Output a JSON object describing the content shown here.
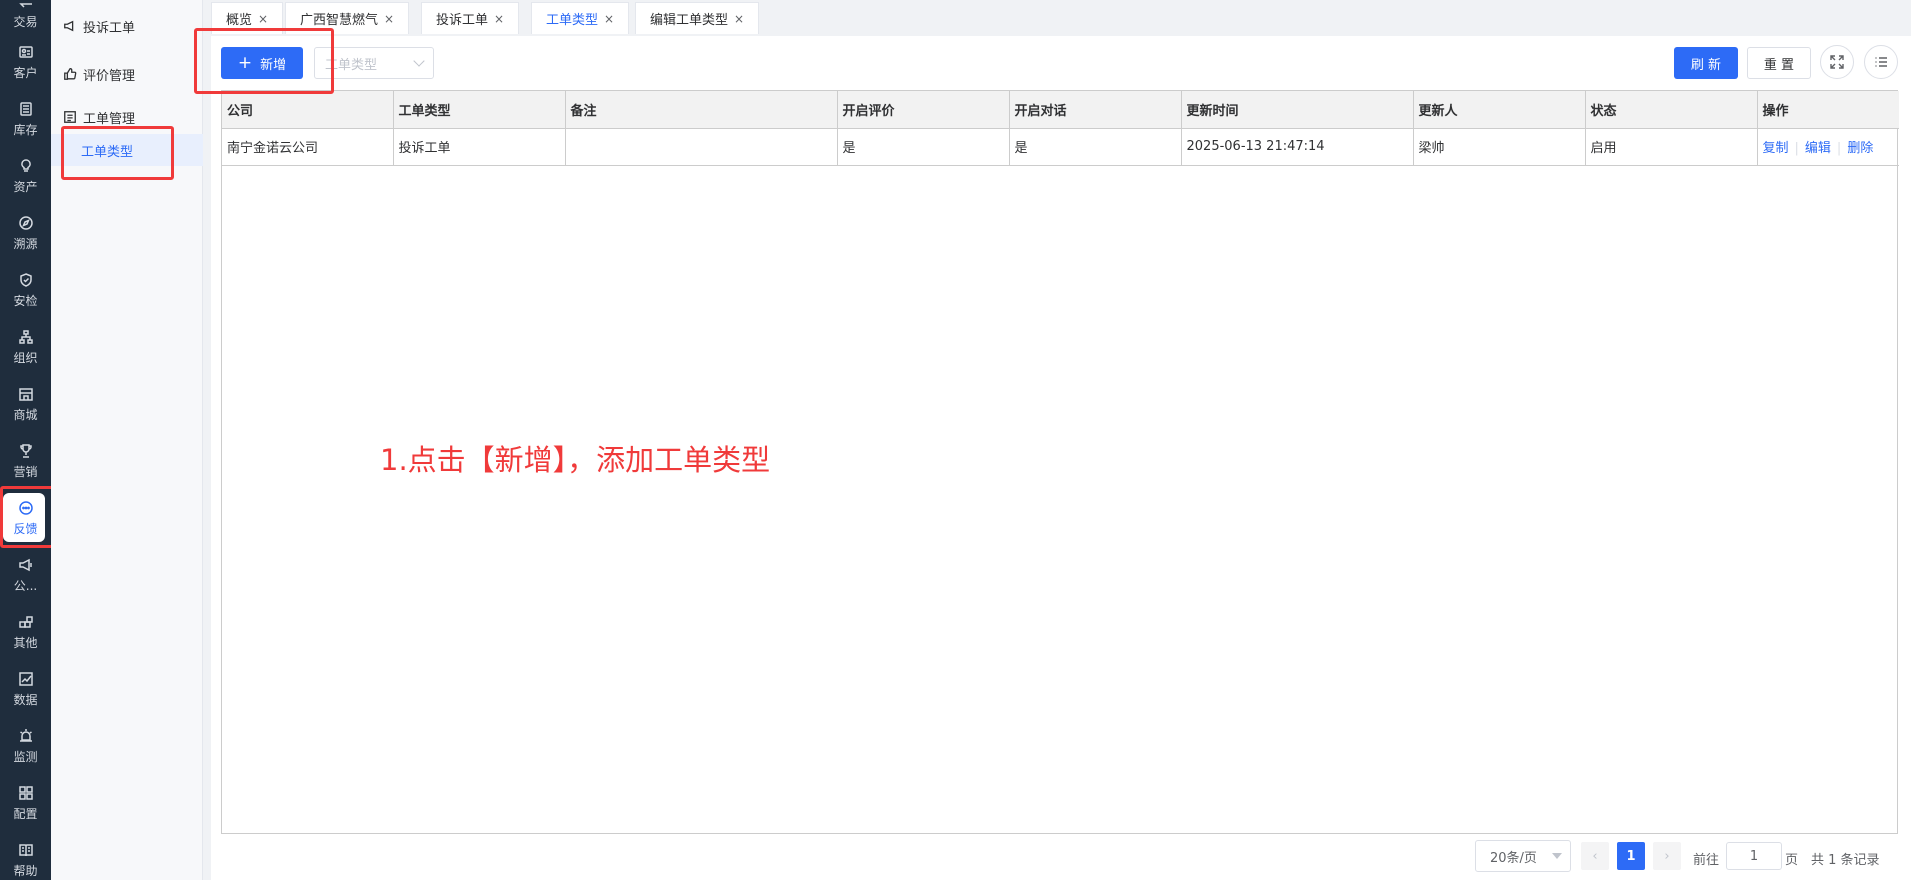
{
  "rail": {
    "items": [
      {
        "label": "交易",
        "icon": "exchange-icon"
      },
      {
        "label": "客户",
        "icon": "id-card-icon"
      },
      {
        "label": "库存",
        "icon": "inventory-icon"
      },
      {
        "label": "资产",
        "icon": "lightbulb-icon"
      },
      {
        "label": "溯源",
        "icon": "compass-icon"
      },
      {
        "label": "安检",
        "icon": "shield-check-icon"
      },
      {
        "label": "组织",
        "icon": "org-chart-icon"
      },
      {
        "label": "商城",
        "icon": "store-icon"
      },
      {
        "label": "营销",
        "icon": "trophy-icon"
      },
      {
        "label": "反馈",
        "icon": "chat-bubble-icon",
        "active": true
      },
      {
        "label": "公...",
        "icon": "megaphone-icon"
      },
      {
        "label": "其他",
        "icon": "blocks-icon"
      },
      {
        "label": "数据",
        "icon": "line-chart-icon"
      },
      {
        "label": "监测",
        "icon": "alarm-icon"
      },
      {
        "label": "配置",
        "icon": "grid-icon"
      },
      {
        "label": "帮助",
        "icon": "book-icon"
      }
    ]
  },
  "submenu": {
    "items": [
      {
        "label": "投诉工单",
        "icon": "megaphone-icon"
      },
      {
        "label": "评价管理",
        "icon": "thumbs-up-icon"
      },
      {
        "label": "工单管理",
        "icon": "list-box-icon"
      },
      {
        "label": "工单类型",
        "child": true,
        "selected": true
      }
    ]
  },
  "tabs": [
    {
      "label": "概览",
      "close": "×"
    },
    {
      "label": "广西智慧燃气",
      "close": "×"
    },
    {
      "label": "投诉工单",
      "close": "×"
    },
    {
      "label": "工单类型",
      "close": "×",
      "active": true
    },
    {
      "label": "编辑工单类型",
      "close": "×"
    }
  ],
  "toolbar": {
    "add_label": "新增",
    "add_icon": "+",
    "type_placeholder": "工单类型",
    "refresh_label": "刷 新",
    "reset_label": "重 置"
  },
  "table": {
    "columns": [
      "公司",
      "工单类型",
      "备注",
      "开启评价",
      "开启对话",
      "更新时间",
      "更新人",
      "状态",
      "操作"
    ],
    "rows": [
      {
        "company": "南宁金诺云公司",
        "type": "投诉工单",
        "remark": "",
        "enable_rating": "是",
        "enable_dialog": "是",
        "updated_at": "2025-06-13 21:47:14",
        "updated_by": "梁帅",
        "status": "启用",
        "actions": [
          "复制",
          "编辑",
          "删除"
        ]
      }
    ]
  },
  "annotation": {
    "text": "1.点击【新增】，添加工单类型",
    "color": "#f03a3a"
  },
  "pagination": {
    "page_size": "20条/页",
    "current_page": "1",
    "goto_prefix": "前往",
    "goto_value": "1",
    "goto_suffix": "页",
    "total": "共 1 条记录"
  },
  "colors": {
    "accent": "#2d6bf6",
    "rail_bg": "#1f2d3d",
    "annotation": "#f03a3a"
  }
}
